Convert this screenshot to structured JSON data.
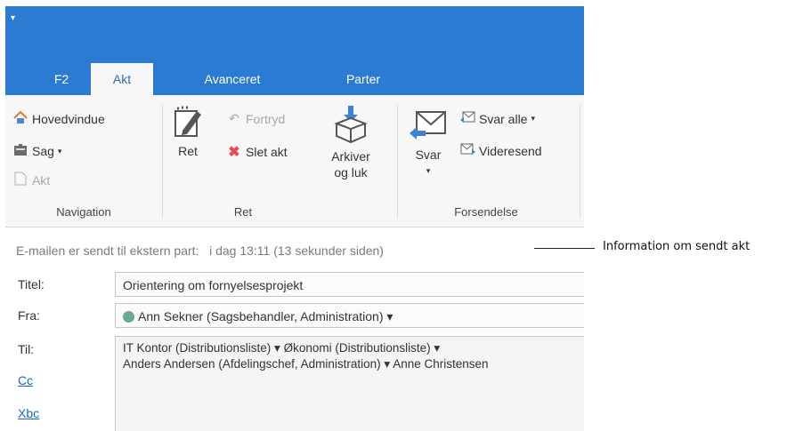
{
  "quick_access": "▾",
  "tabs": [
    {
      "label": "F2"
    },
    {
      "label": "Akt",
      "active": true
    },
    {
      "label": "Avanceret"
    },
    {
      "label": "Parter"
    }
  ],
  "ribbon": {
    "navigation": {
      "items": [
        "Hovedvindue",
        "Sag",
        "Akt"
      ],
      "group_label": "Navigation"
    },
    "ret": {
      "big_button": "Ret",
      "items": [
        "Fortryd",
        "Slet akt"
      ],
      "group_label": "Ret"
    },
    "arkiver": {
      "line1": "Arkiver",
      "line2": "og luk"
    },
    "forsendelse": {
      "svar": "Svar",
      "items": [
        "Svar alle",
        "Videresend"
      ],
      "group_label": "Forsendelse"
    }
  },
  "info_bar": {
    "label": "E-mailen er sendt til ekstern part:",
    "time": "i dag 13:11 (13 sekunder siden)"
  },
  "form": {
    "title_label": "Titel:",
    "title_value": "Orientering om fornyelsesprojekt",
    "from_label": "Fra:",
    "from_value": "Ann Sekner (Sagsbehandler, Administration) ▾",
    "to_label": "Til:",
    "cc_label": "Cc",
    "bcc_label": "Xbc",
    "to_line1": "IT Kontor (Distributionsliste) ▾   Økonomi (Distributionsliste) ▾",
    "to_line2": "Anders Andersen (Afdelingschef, Administration) ▾    Anne Christensen"
  },
  "callout": "Information om sendt akt",
  "colors": {
    "accent": "#2b7bd3",
    "presence": "#6aab8e",
    "delete": "#e84b55"
  }
}
